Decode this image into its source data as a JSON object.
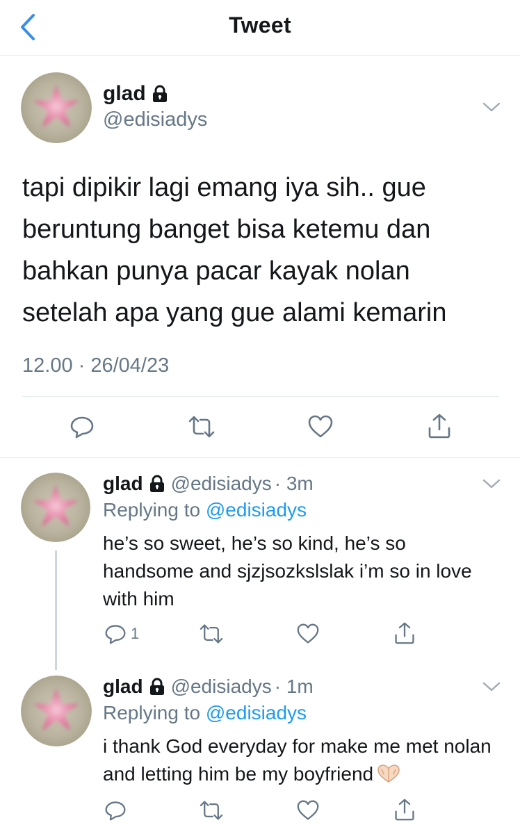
{
  "header": {
    "title": "Tweet"
  },
  "main_tweet": {
    "name": "glad",
    "handle": "@edisiadys",
    "text": "tapi dipikir lagi emang iya sih.. gue beruntung banget bisa ketemu dan bahkan punya pacar kayak nolan setelah apa yang gue alami kemarin",
    "timestamp": "12.00 · 26/04/23"
  },
  "replies": [
    {
      "name": "glad",
      "handle": "@edisiadys",
      "time": "· 3m",
      "replying_prefix": "Replying to ",
      "replying_to": "@edisiadys",
      "text": "he’s so sweet, he’s so kind, he’s so handsome and sjzjsozkslslak i’m so in love with him",
      "reply_count": "1"
    },
    {
      "name": "glad",
      "handle": "@edisiadys",
      "time": "· 1m",
      "replying_prefix": "Replying to ",
      "replying_to": "@edisiadys",
      "text": "i thank God everyday for make me met nolan and letting him be my boyfriend",
      "reply_count": ""
    }
  ],
  "colors": {
    "text": "#14171a",
    "secondary": "#657786",
    "link": "#1d9bf0",
    "accent_back": "#3a8ee6",
    "divider": "#e6ecf0"
  },
  "icons": [
    "back-chevron-icon",
    "lock-icon",
    "chevron-down-icon",
    "reply-icon",
    "retweet-icon",
    "like-icon",
    "share-icon",
    "heart-hands-emoji"
  ]
}
